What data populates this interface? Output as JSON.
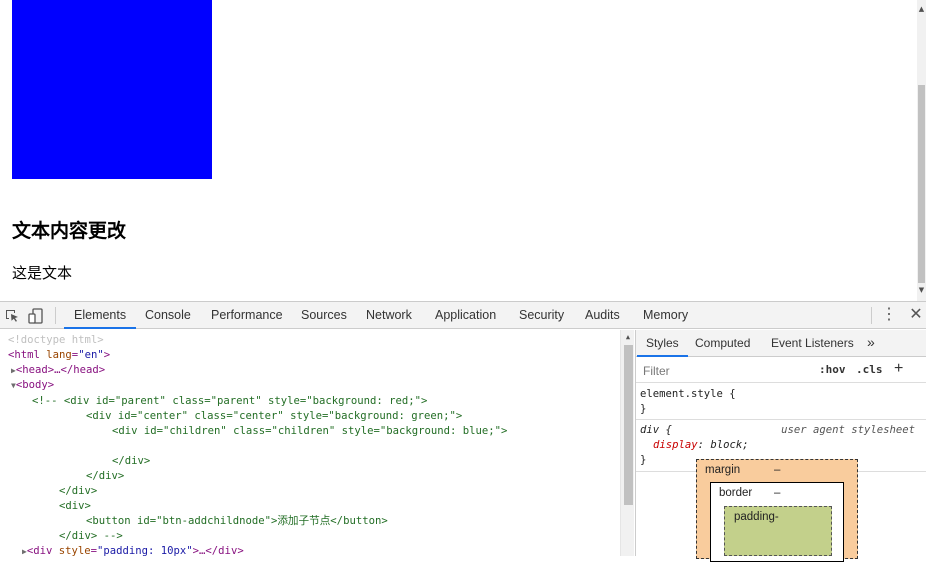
{
  "page": {
    "heading": "文本内容更改",
    "text": "这是文本",
    "box_color": "#0000ff"
  },
  "devtools": {
    "tabs": [
      "Elements",
      "Console",
      "Performance",
      "Sources",
      "Network",
      "Application",
      "Security",
      "Audits",
      "Memory"
    ],
    "active_tab": "Elements",
    "icons": {
      "inspect": "inspect-element-icon",
      "device": "device-toolbar-icon",
      "menu": "more-options-icon",
      "close": "close-icon"
    },
    "menu_glyph": "⋮",
    "close_glyph": "✕"
  },
  "elements": {
    "lines": [
      {
        "kind": "doctype",
        "text": "<!doctype html>"
      },
      {
        "kind": "tag",
        "open": "<html ",
        "attrs": [
          [
            "lang",
            "\"en\""
          ]
        ],
        "close": ">"
      },
      {
        "kind": "collapsed",
        "text": "<head>…</head>"
      },
      {
        "kind": "expanded",
        "text": "<body>"
      },
      {
        "kind": "comment",
        "text": "<!-- <div id=\"parent\" class=\"parent\" style=\"background: red;\">"
      },
      {
        "kind": "comment",
        "text": "<div id=\"center\" class=\"center\" style=\"background: green;\">"
      },
      {
        "kind": "comment",
        "text": "<div id=\"children\" class=\"children\" style=\"background: blue;\">"
      },
      {
        "kind": "comment",
        "text": ""
      },
      {
        "kind": "comment",
        "text": "</div>"
      },
      {
        "kind": "comment",
        "text": "</div>"
      },
      {
        "kind": "comment",
        "text": "</div>"
      },
      {
        "kind": "comment",
        "text": "<div>"
      },
      {
        "kind": "comment",
        "text": "<button id=\"btn-addchildnode\">添加子节点</button>"
      },
      {
        "kind": "comment",
        "text": "</div> -->"
      },
      {
        "kind": "tag",
        "open": "<div ",
        "attrs": [
          [
            "style",
            "\"padding: 10px\""
          ]
        ],
        "close": ">…</div>"
      }
    ]
  },
  "styles": {
    "tabs": [
      "Styles",
      "Computed",
      "Event Listeners"
    ],
    "active_tab": "Styles",
    "more_glyph": "»",
    "filter_placeholder": "Filter",
    "hov": ":hov",
    "cls": ".cls",
    "add": "+",
    "element_style": {
      "selector": "element.style {",
      "close": "}"
    },
    "rule": {
      "selector": "div {",
      "origin": "user agent stylesheet",
      "prop_name": "display",
      "prop_value": "block;",
      "close": "}"
    },
    "box_model": {
      "margin_label": "margin",
      "margin_value": "–",
      "border_label": "border",
      "border_value": "–",
      "padding_label": "padding-"
    }
  }
}
